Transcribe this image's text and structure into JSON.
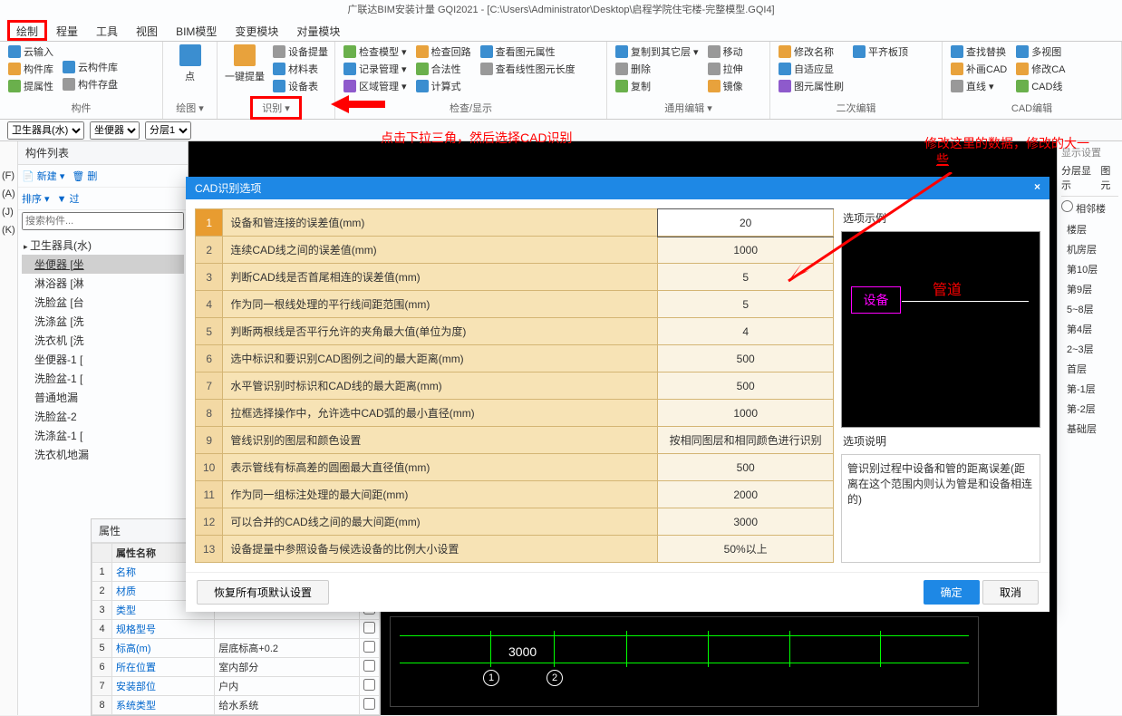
{
  "app": {
    "title": "广联达BIM安装计量 GQI2021 - [C:\\Users\\Administrator\\Desktop\\启程学院住宅楼-完整模型.GQI4]"
  },
  "menu": {
    "items": [
      "绘制",
      "程量",
      "工具",
      "视图",
      "BIM模型",
      "变更模块",
      "对量模块"
    ]
  },
  "ribbon": {
    "group1_label": "构件",
    "cloud_import": "云输入",
    "component_lib": "构件库",
    "cloud_lib": "云构件库",
    "prop_extract": "提属性",
    "component_save": "构件存盘",
    "group2_label": "绘图 ▾",
    "point": "点",
    "one_key": "一键提量",
    "group3_label": "识别 ▾",
    "device_extract": "设备提量",
    "material": "材料表",
    "device_table": "设备表",
    "check_model": "检查模型 ▾",
    "record_mgmt": "记录管理 ▾",
    "zone_mgmt": "区域管理 ▾",
    "check_loop": "检查回路",
    "validity": "合法性",
    "calc_formula": "计算式",
    "view_elem_attr": "查看图元属性",
    "view_linear_len": "查看线性图元长度",
    "group4_label": "检查/显示",
    "copy_other": "复制到其它层 ▾",
    "move": "移动",
    "delete": "删除",
    "stretch": "拉伸",
    "copy": "复制",
    "mirror": "镜像",
    "group5_label": "通用编辑 ▾",
    "modify_name": "修改名称",
    "adaptive": "自适应显",
    "elem_prop_brush": "图元属性刷",
    "flatten": "平齐板顶",
    "group6_label": "二次编辑",
    "find_replace": "查找替换",
    "fill_cad": "补画CAD",
    "line": "直线 ▾",
    "multi_view": "多视图",
    "modify_cad": "修改CA",
    "cad_line": "CAD线",
    "group7_label": "CAD编辑"
  },
  "selectors": {
    "s1": "卫生器具(水)",
    "s2": "坐便器",
    "s3": "分层1"
  },
  "component_panel": {
    "title": "构件列表",
    "new_btn": "新建 ▾",
    "del_btn": "删",
    "sort_btn": "排序 ▾",
    "filter_btn": "过",
    "search_placeholder": "搜索构件...",
    "parent": "卫生器具(水)",
    "items": [
      "坐便器 [坐",
      "淋浴器 [淋",
      "洗脸盆 [台",
      "洗涤盆 [洗",
      "洗衣机 [洗",
      "坐便器-1 [",
      "洗脸盆-1 [",
      "普通地漏",
      "洗脸盆-2",
      "洗涤盆-1 [",
      "洗衣机地漏"
    ]
  },
  "left_labels": [
    "",
    "(F)",
    "(A)",
    "(J)",
    "(K)"
  ],
  "prop_panel": {
    "title": "属性",
    "col_num": "",
    "col_name": "属性名称",
    "col_val": "",
    "col_cb": "",
    "rows": [
      {
        "n": "1",
        "name": "名称",
        "val": ""
      },
      {
        "n": "2",
        "name": "材质",
        "val": ""
      },
      {
        "n": "3",
        "name": "类型",
        "val": ""
      },
      {
        "n": "4",
        "name": "规格型号",
        "val": ""
      },
      {
        "n": "5",
        "name": "标高(m)",
        "val": "层底标高+0.2"
      },
      {
        "n": "6",
        "name": "所在位置",
        "val": "室内部分"
      },
      {
        "n": "7",
        "name": "安装部位",
        "val": "户内"
      },
      {
        "n": "8",
        "name": "系统类型",
        "val": "给水系统"
      }
    ]
  },
  "modal": {
    "title": "CAD识别选项",
    "close": "×",
    "legend_label": "选项示例",
    "desc_label": "选项说明",
    "desc_text": "管识别过程中设备和管的距离误差(距离在这个范围内则认为管是和设备相连的)",
    "preview_dev": "设备",
    "preview_pipe": "管道",
    "restore": "恢复所有项默认设置",
    "ok": "确定",
    "cancel": "取消",
    "rows": [
      {
        "i": "1",
        "label": "设备和管连接的误差值(mm)",
        "val": "20"
      },
      {
        "i": "2",
        "label": "连续CAD线之间的误差值(mm)",
        "val": "1000"
      },
      {
        "i": "3",
        "label": "判断CAD线是否首尾相连的误差值(mm)",
        "val": "5"
      },
      {
        "i": "4",
        "label": "作为同一根线处理的平行线间距范围(mm)",
        "val": "5"
      },
      {
        "i": "5",
        "label": "判断两根线是否平行允许的夹角最大值(单位为度)",
        "val": "4"
      },
      {
        "i": "6",
        "label": "选中标识和要识别CAD图例之间的最大距离(mm)",
        "val": "500"
      },
      {
        "i": "7",
        "label": "水平管识别时标识和CAD线的最大距离(mm)",
        "val": "500"
      },
      {
        "i": "8",
        "label": "拉框选择操作中，允许选中CAD弧的最小直径(mm)",
        "val": "1000"
      },
      {
        "i": "9",
        "label": "管线识别的图层和颜色设置",
        "val": "按相同图层和相同颜色进行识别"
      },
      {
        "i": "10",
        "label": "表示管线有标高差的圆圈最大直径值(mm)",
        "val": "500"
      },
      {
        "i": "11",
        "label": "作为同一组标注处理的最大间距(mm)",
        "val": "2000"
      },
      {
        "i": "12",
        "label": "可以合并的CAD线之间的最大间距(mm)",
        "val": "3000"
      },
      {
        "i": "13",
        "label": "设备提量中参照设备与候选设备的比例大小设置",
        "val": "50%以上"
      }
    ]
  },
  "right_panel": {
    "header1": "显示设置",
    "header2": "分层显示",
    "header3": "图元",
    "radio": "相邻楼",
    "floors": [
      "楼层",
      "机房层",
      "第10层",
      "第9层",
      "5~8层",
      "第4层",
      "2~3层",
      "首层",
      "第-1层",
      "第-2层",
      "基础层"
    ]
  },
  "annotations": {
    "text1": "点击下拉三角，然后选择CAD识别",
    "text2": "修改这里的数据，修改的大一",
    "text2b": "些"
  },
  "canvas": {
    "dim": "3000"
  }
}
